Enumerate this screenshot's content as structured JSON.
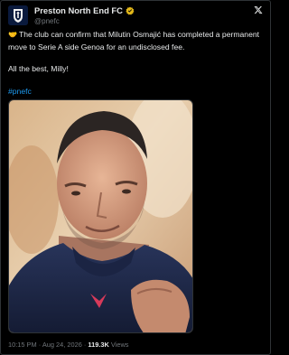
{
  "account": {
    "display_name": "Preston North End FC",
    "handle": "@pnefc",
    "verified": true
  },
  "icons": {
    "avatar": "pnefc-crest-icon",
    "verified": "verified-badge-icon",
    "platform": "x-logo-icon",
    "emoji": "handshake-emoji-icon"
  },
  "tweet": {
    "emoji": "🤝",
    "text": "The club can confirm that Milutin Osmajić has completed a permanent move to Serie A side Genoa for an undisclosed fee.",
    "sign_off": "All the best, Milly!",
    "hashtag": "#pnefc"
  },
  "footer": {
    "time": "10:15 PM",
    "separator": "·",
    "date": "Aug 24, 2026",
    "views_count": "119.3K",
    "views_label": "Views"
  },
  "colors": {
    "background": "#000000",
    "text": "#e7e9ea",
    "muted": "#71767b",
    "link": "#1d9bf0",
    "verified": "#1d9bf0"
  }
}
